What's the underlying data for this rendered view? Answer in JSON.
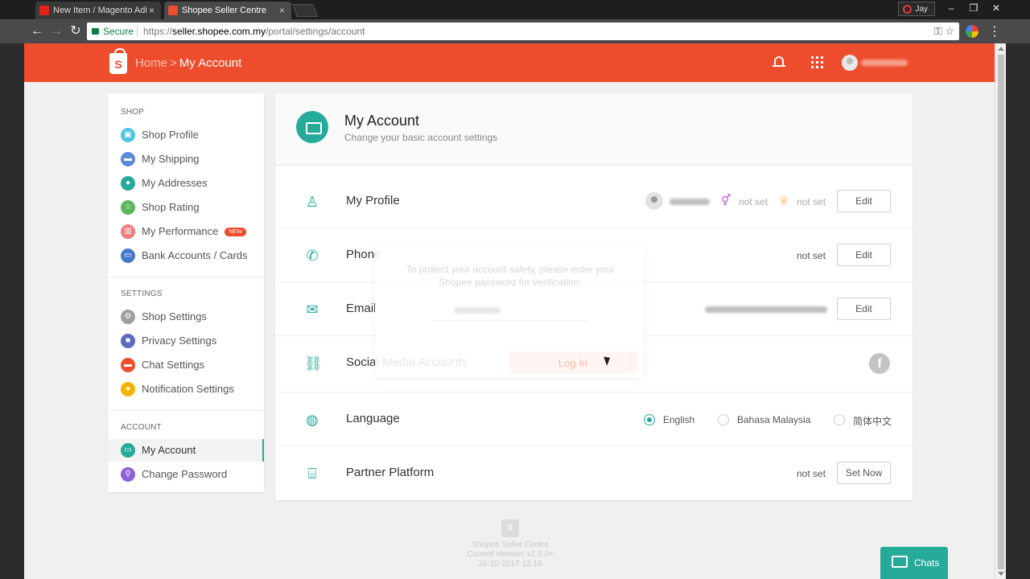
{
  "browser": {
    "tabs": [
      {
        "title": "New Item / Magento Adi",
        "favicon_color": "#e2231a"
      },
      {
        "title": "Shopee Seller Centre",
        "favicon_color": "#ee4d2d"
      }
    ],
    "user": "Jay",
    "secure_label": "Secure",
    "url_scheme": "https://",
    "url_host": "seller.shopee.com.my",
    "url_path": "/portal/settings/account"
  },
  "header": {
    "logo_letter": "S",
    "crumb_home": "Home",
    "crumb_sep": ">",
    "crumb_current": "My Account",
    "brand_color": "#ee4d2d"
  },
  "sidebar": {
    "sections": [
      {
        "title": "SHOP",
        "items": [
          {
            "label": "Shop Profile",
            "icon": "store-icon",
            "color": "#4fc3e0"
          },
          {
            "label": "My Shipping",
            "icon": "truck-icon",
            "color": "#5b8ad8"
          },
          {
            "label": "My Addresses",
            "icon": "pin-icon",
            "color": "#26aa99"
          },
          {
            "label": "Shop Rating",
            "icon": "star-icon",
            "color": "#5cb85c"
          },
          {
            "label": "My Performance",
            "icon": "chart-icon",
            "color": "#f07c7c",
            "badge": "NEW"
          },
          {
            "label": "Bank Accounts / Cards",
            "icon": "card-icon",
            "color": "#4a78c9"
          }
        ]
      },
      {
        "title": "SETTINGS",
        "items": [
          {
            "label": "Shop Settings",
            "icon": "gear-icon",
            "color": "#9e9e9e"
          },
          {
            "label": "Privacy Settings",
            "icon": "lock-icon",
            "color": "#5c6bc0"
          },
          {
            "label": "Chat Settings",
            "icon": "chat-icon",
            "color": "#ee4d2d"
          },
          {
            "label": "Notification Settings",
            "icon": "bell-icon",
            "color": "#f5b400"
          }
        ]
      },
      {
        "title": "ACCOUNT",
        "items": [
          {
            "label": "My Account",
            "icon": "id-card-icon",
            "color": "#26aa99",
            "active": true
          },
          {
            "label": "Change Password",
            "icon": "key-icon",
            "color": "#8e63d8"
          }
        ]
      }
    ]
  },
  "main": {
    "title": "My Account",
    "subtitle": "Change your basic account settings",
    "accent": "#26aa99",
    "rows": {
      "profile": {
        "label": "My Profile",
        "gender": "not set",
        "birthday": "not set",
        "button": "Edit"
      },
      "phone": {
        "label": "Phone",
        "value": "not set",
        "button": "Edit"
      },
      "email": {
        "label": "Email",
        "button": "Edit"
      },
      "social": {
        "label": "Social Media Accounts",
        "facebook_letter": "f"
      },
      "language": {
        "label": "Language",
        "options": [
          "English",
          "Bahasa Malaysia",
          "简体中文"
        ],
        "selected": "English"
      },
      "partner": {
        "label": "Partner Platform",
        "value": "not set",
        "button": "Set Now"
      }
    }
  },
  "modal": {
    "message": "To protect your account safety, please enter your Shopee password for verification.",
    "button": "Log In"
  },
  "footer": {
    "logo_letter": "S",
    "line1": "Shopee Seller Centre",
    "line2": "Current Version: v1.5.0+",
    "line3": "26-10-2017 12:16"
  },
  "chats": {
    "label": "Chats"
  }
}
